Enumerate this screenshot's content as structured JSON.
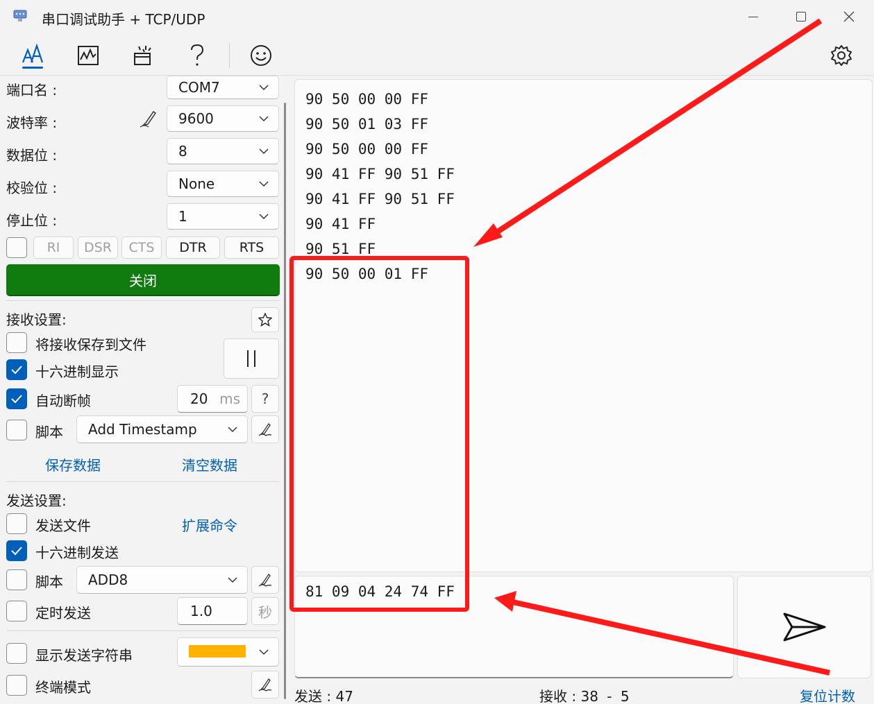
{
  "window": {
    "title": "串口调试助手 + TCP/UDP"
  },
  "serial": {
    "port_label": "端口名 :",
    "port_value": "COM7",
    "baud_label": "波特率 :",
    "baud_value": "9600",
    "databits_label": "数据位 :",
    "databits_value": "8",
    "parity_label": "校验位 :",
    "parity_value": "None",
    "stopbits_label": "停止位 :",
    "stopbits_value": "1",
    "pins": [
      "RI",
      "DSR",
      "CTS",
      "DTR",
      "RTS"
    ],
    "close_label": "关闭"
  },
  "receive": {
    "section_label": "接收设置:",
    "save_to_file": "将接收保存到文件",
    "hex_display": "十六进制显示",
    "auto_frame": "自动断帧",
    "frame_value": "20",
    "frame_unit": "ms",
    "help_label": "?",
    "script_label": "脚本",
    "script_value": "Add Timestamp",
    "save_data": "保存数据",
    "clear_data": "清空数据"
  },
  "send": {
    "section_label": "发送设置:",
    "send_file": "发送文件",
    "ext_cmd": "扩展命令",
    "hex_send": "十六进制发送",
    "script_label": "脚本",
    "script_value": "ADD8",
    "timed_send": "定时发送",
    "timed_value": "1.0",
    "timed_unit": "秒",
    "show_string": "显示发送字符串",
    "terminal_mode": "终端模式",
    "string_color": "#ffb300"
  },
  "rx_lines": [
    "90 50 00 00 FF",
    "90 50 01 03 FF",
    "90 50 00 00 FF",
    "90 41 FF 90 51 FF",
    "90 41 FF 90 51 FF",
    "90 41 FF",
    "90 51 FF",
    "90 50 00 01 FF"
  ],
  "tx_text": "81 09 04 24 74 FF",
  "status": {
    "sent_label": "发送 :",
    "sent_value": "47",
    "recv_label": "接收 :",
    "recv_value": "38",
    "recv_sep": "-",
    "recv_extra": "5",
    "reset_label": "复位计数"
  },
  "colors": {
    "accent": "#005fb8",
    "open_button": "#107c10",
    "annotation": "#ff1a1a"
  }
}
